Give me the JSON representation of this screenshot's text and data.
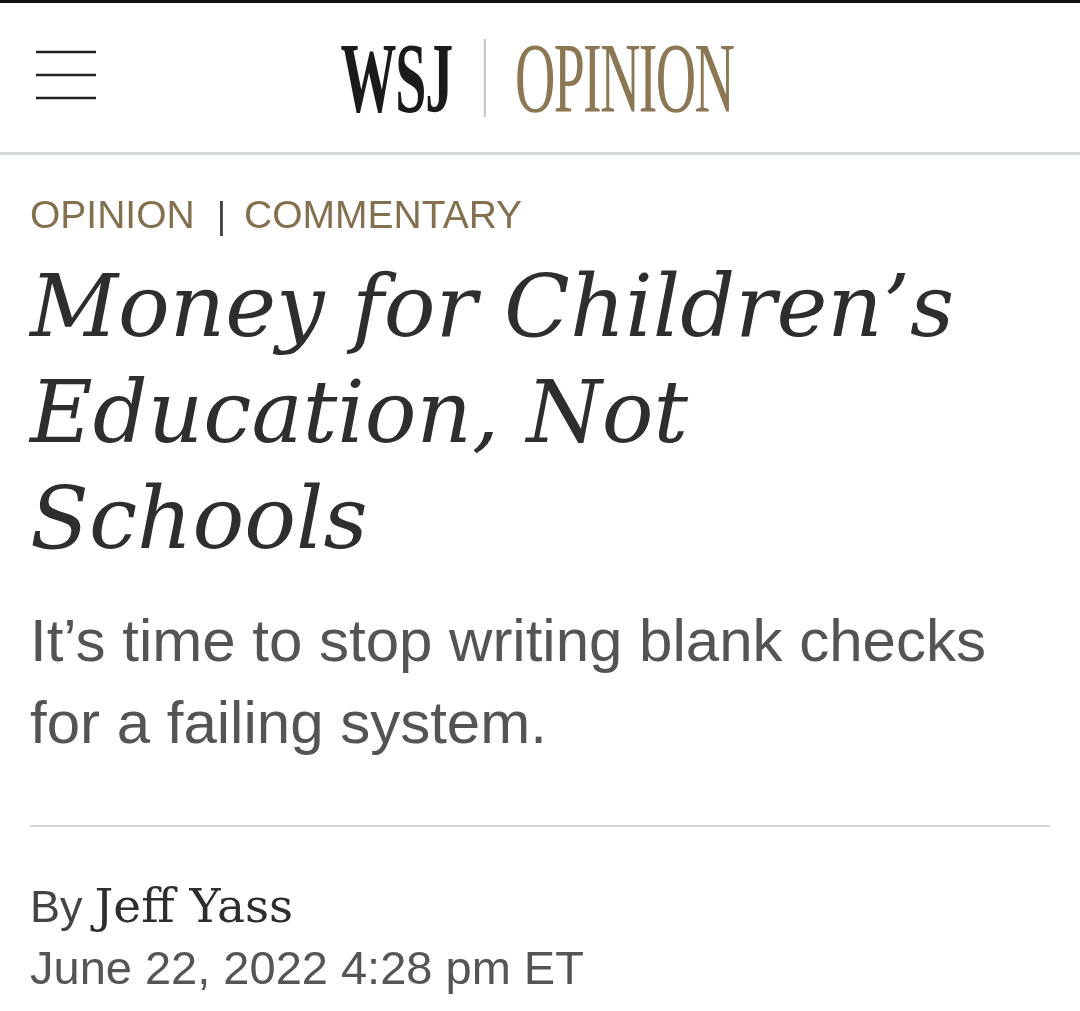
{
  "header": {
    "menu": {
      "kind": "hamburger"
    },
    "logo": {
      "masthead": "WSJ",
      "section": "OPINION"
    }
  },
  "article": {
    "breadcrumb": [
      {
        "label": "OPINION"
      },
      {
        "label": "COMMENTARY"
      }
    ],
    "separator": "|",
    "headline": "Money for Children’s Education, Not Schools",
    "subheadline": "It’s time to stop writing blank checks for a failing system.",
    "byline": {
      "prefix": "By",
      "author": "Jeff Yass"
    },
    "dateline": "June 22, 2022 4:28 pm ET"
  }
}
